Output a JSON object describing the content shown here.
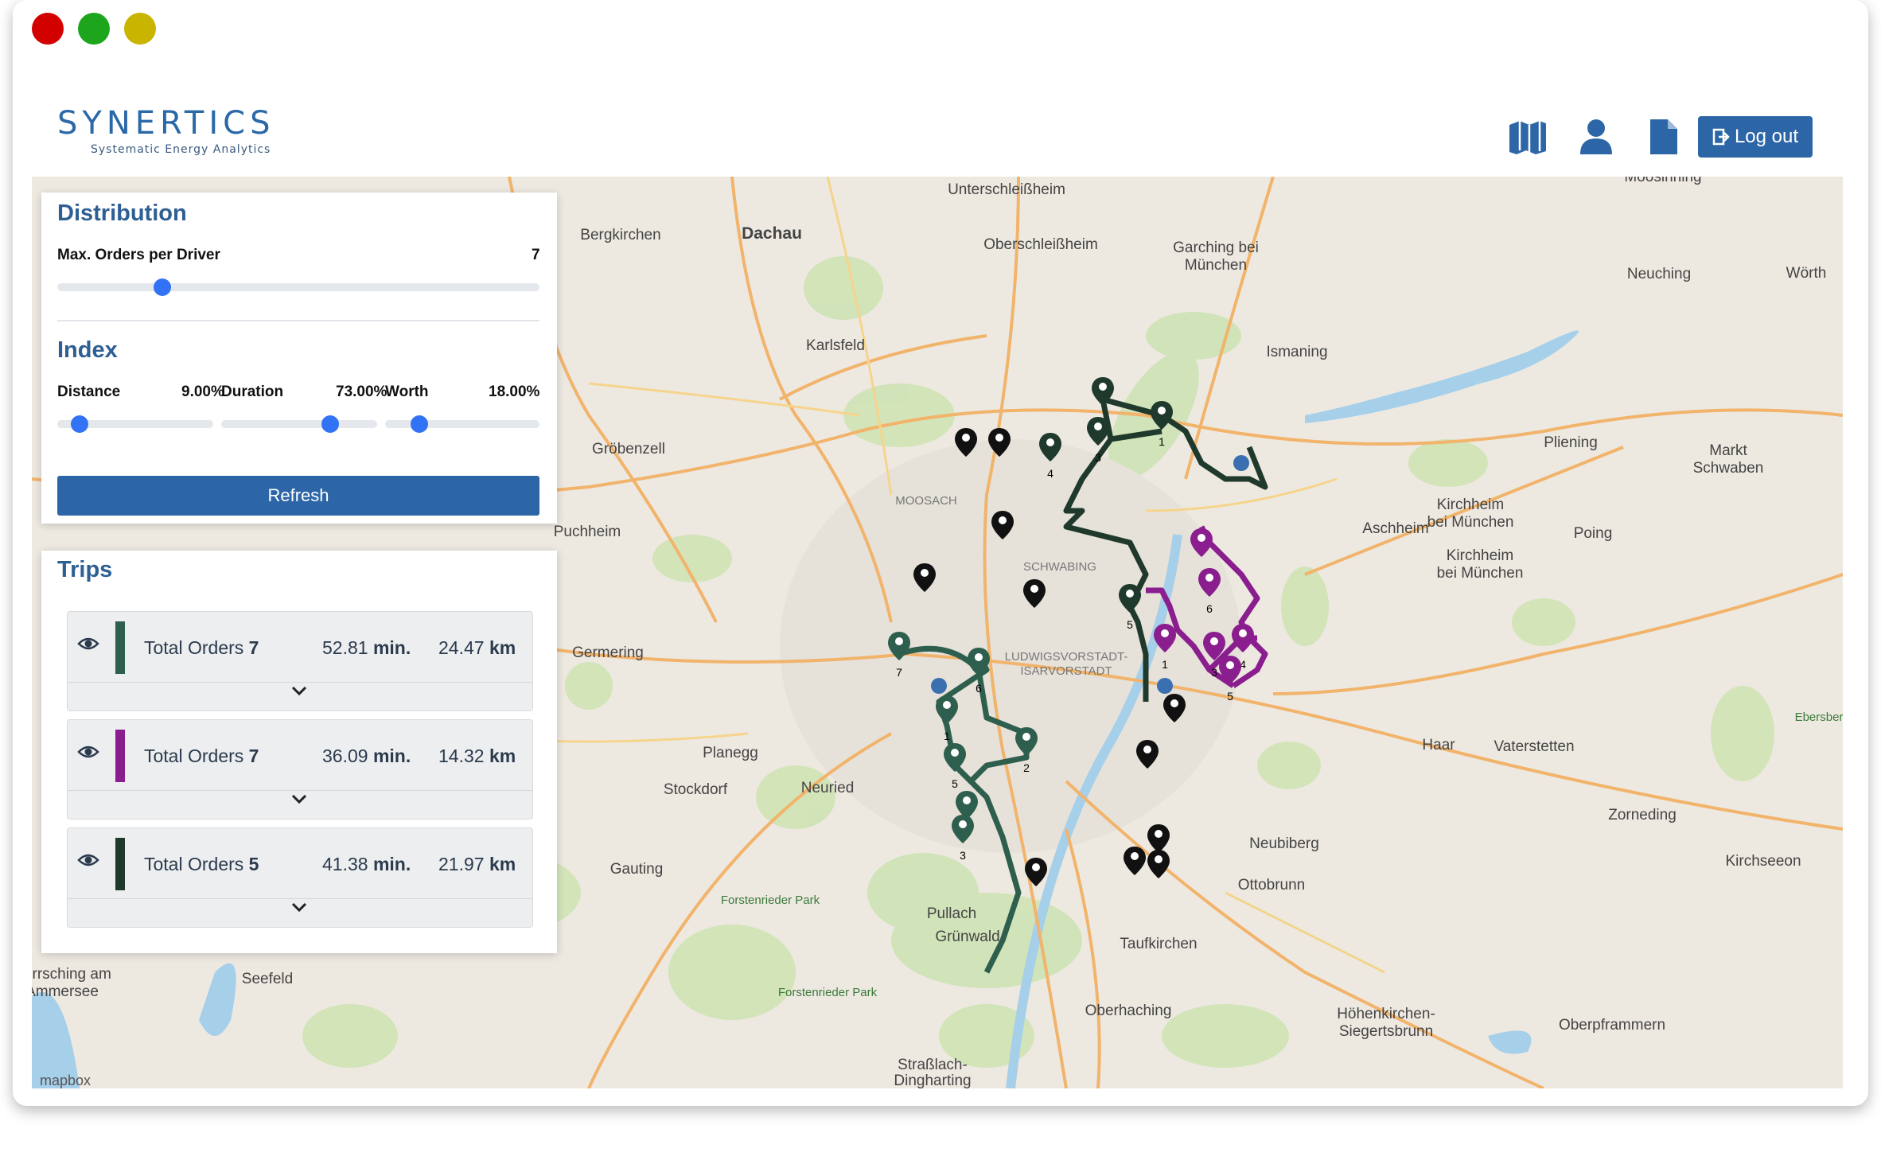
{
  "brand": {
    "name": "SYNERTICS",
    "tagline": "Systematic Energy Analytics"
  },
  "window_controls": {
    "close_color": "#d30000",
    "minimize_color": "#1da51d",
    "maximize_color": "#c9b400"
  },
  "header": {
    "icons": [
      "map-icon",
      "user-icon",
      "document-icon"
    ],
    "logout_label": "Log out"
  },
  "distribution": {
    "title": "Distribution",
    "max_orders_label": "Max. Orders per Driver",
    "max_orders_value": "7",
    "max_orders_slider_fraction": 0.22
  },
  "index": {
    "title": "Index",
    "distance_label": "Distance",
    "distance_value": "9.00%",
    "duration_label": "Duration",
    "duration_value": "73.00%",
    "worth_label": "Worth",
    "worth_value": "18.00%",
    "refresh_label": "Refresh"
  },
  "trips": {
    "title": "Trips",
    "items": [
      {
        "prefix": "Total Orders",
        "orders": "7",
        "minutes": "52.81",
        "min_unit": "min.",
        "km": "24.47",
        "km_unit": "km",
        "color": "#2e5f4e"
      },
      {
        "prefix": "Total Orders",
        "orders": "7",
        "minutes": "36.09",
        "min_unit": "min.",
        "km": "14.32",
        "km_unit": "km",
        "color": "#8b1e8e"
      },
      {
        "prefix": "Total Orders",
        "orders": "5",
        "minutes": "41.38",
        "min_unit": "min.",
        "km": "21.97",
        "km_unit": "km",
        "color": "#1f3a2c"
      }
    ]
  },
  "map": {
    "attribution": "mapbox",
    "places": [
      "Unterschleißheim",
      "Dachau",
      "Bergkirchen",
      "Oberschleißheim",
      "Garching bei München",
      "Neuching",
      "Wörth",
      "Karlsfeld",
      "Ismaning",
      "Gröbenzell",
      "Puchheim",
      "Moosach",
      "Schwabing",
      "Pliening",
      "Markt Schwaben",
      "Kirchheim bei München",
      "Aschheim",
      "Poing",
      "Germering",
      "Ludwigsvorstadt-Isarvorstadt",
      "Planegg",
      "Stockdorf",
      "Neuried",
      "Haar",
      "Vaterstetten",
      "Zorneding",
      "Gauting",
      "Forstenrieder Park",
      "Pullach",
      "Grünwald",
      "Neubiberg",
      "Ottobrunn",
      "Taufkirchen",
      "Kirchseeon",
      "Herrsching am Ammersee",
      "Seefeld",
      "Oberhaching",
      "Höhenkirchen-Siegertsbrunn",
      "Oberpframmern",
      "Straßlach-Dingharting",
      "Ebersber",
      "Moosinning"
    ],
    "route_colors": {
      "trip1": "#2e5f4e",
      "trip2": "#8b1e8e",
      "trip3": "#1f3a2c",
      "depot": "#3a6fb0"
    }
  }
}
